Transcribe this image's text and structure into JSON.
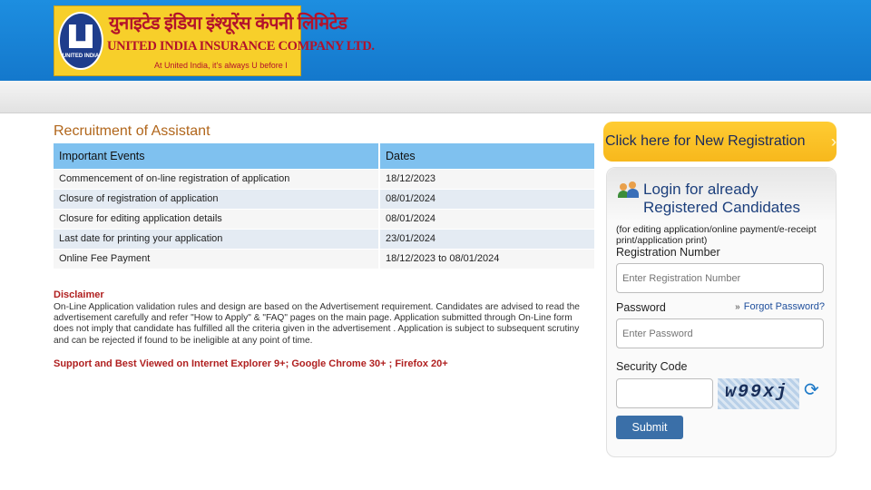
{
  "header": {
    "logo_hindi": "युनाइटेड इंडिया इंश्यूरेंस कंपनी लिमिटेड",
    "logo_english": "UNITED INDIA INSURANCE COMPANY LTD.",
    "logo_tagline": "At United India, it's always U before I",
    "emblem_tag": "UNITED INDIA"
  },
  "page_title": "Recruitment of Assistant",
  "events_table": {
    "headers": [
      "Important Events",
      "Dates"
    ],
    "rows": [
      [
        "Commencement of on-line registration of application",
        "18/12/2023"
      ],
      [
        "Closure of registration of application",
        "08/01/2024"
      ],
      [
        "Closure for editing application details",
        "08/01/2024"
      ],
      [
        "Last date for printing your application",
        "23/01/2024"
      ],
      [
        "Online Fee Payment",
        "18/12/2023 to 08/01/2024"
      ]
    ]
  },
  "disclaimer": {
    "title": "Disclaimer",
    "text": "On-Line Application validation rules and design are based on the Advertisement requirement. Candidates are advised to read the advertisement carefully and refer \"How to Apply\" & \"FAQ\" pages on the main page. Application submitted through On-Line form does not imply that candidate has fulfilled all the criteria given in the advertisement . Application is subject to subsequent scrutiny and can be rejected if found to be ineligible at any point of time."
  },
  "support_text": "Support and Best Viewed on Internet Explorer 9+; Google Chrome 30+ ; Firefox 20+",
  "new_registration": {
    "label": "Click here for New Registration",
    "arrow": "»"
  },
  "login": {
    "title_line1": "Login for already",
    "title_line2": "Registered Candidates",
    "note": "(for editing application/online payment/e-receipt print/application print)",
    "registration_label": "Registration Number",
    "registration_placeholder": "Enter Registration Number",
    "password_label": "Password",
    "password_placeholder": "Enter Password",
    "forgot_label": "Forgot Password?",
    "security_label": "Security Code",
    "captcha_text": "w99xj",
    "submit_label": "Submit"
  },
  "colors": {
    "header_blue": "#1478cc",
    "logo_yellow": "#f7cf2a",
    "table_header": "#7fc1ef",
    "accent_red": "#b02020",
    "button_blue": "#3a6fa8"
  }
}
